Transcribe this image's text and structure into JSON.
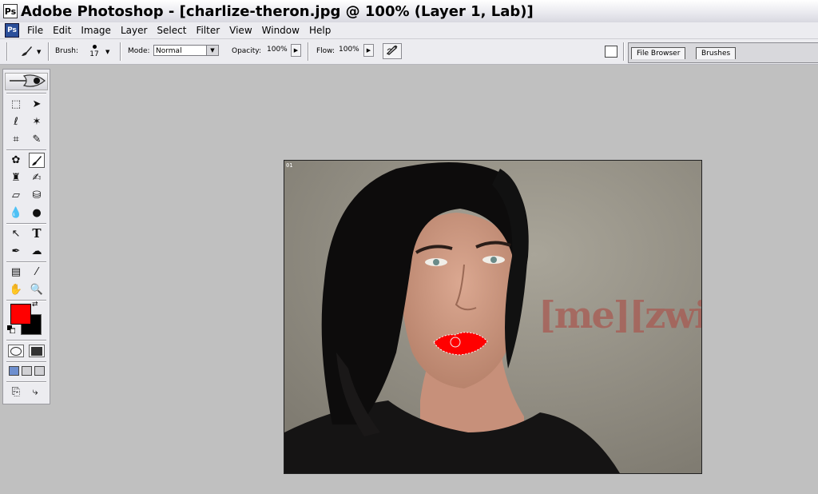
{
  "window": {
    "title": "Adobe Photoshop - [charlize-theron.jpg @ 100% (Layer 1, Lab)]",
    "app_icon": "photoshop-icon"
  },
  "menu": {
    "items": [
      "File",
      "Edit",
      "Image",
      "Layer",
      "Select",
      "Filter",
      "View",
      "Window",
      "Help"
    ]
  },
  "options_bar": {
    "brush_label": "Brush:",
    "brush_size": "17",
    "mode_label": "Mode:",
    "mode_value": "Normal",
    "opacity_label": "Opacity:",
    "opacity_value": "100%",
    "flow_label": "Flow:",
    "flow_value": "100%"
  },
  "palette_well": {
    "tabs": [
      "File Browser",
      "Brushes"
    ]
  },
  "document": {
    "badge": "01",
    "watermark": "[me][zwis]",
    "foreground_color": "#ff0000",
    "background_color": "#000000"
  }
}
